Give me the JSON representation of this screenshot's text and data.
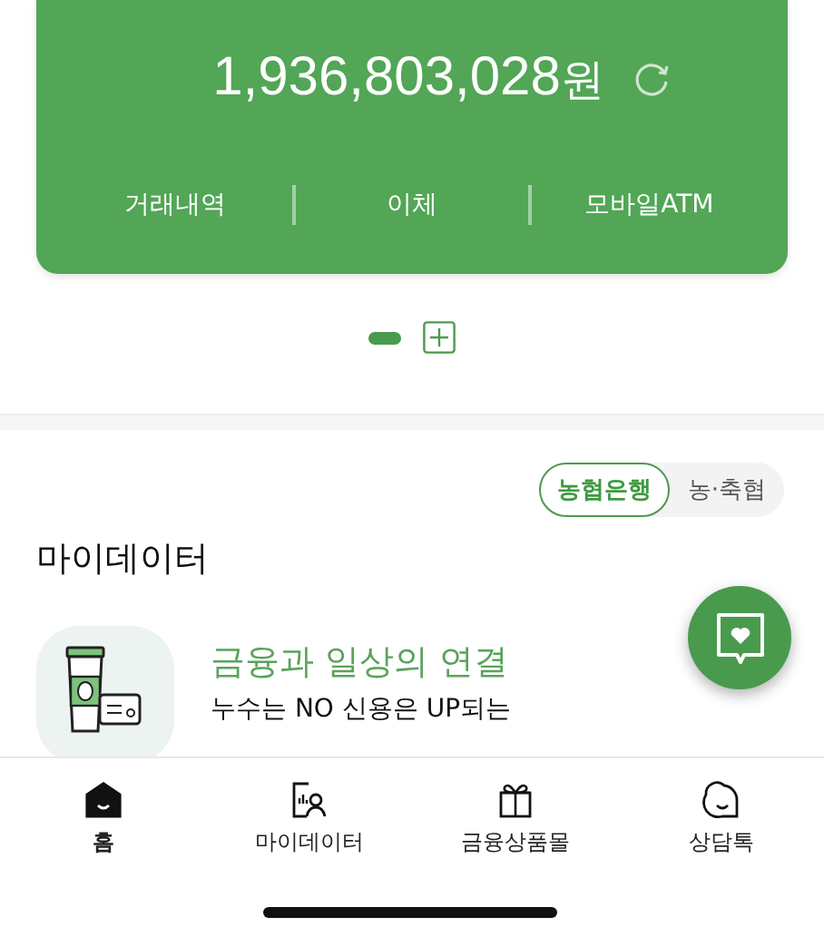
{
  "account_card": {
    "balance": "1,936,803,028",
    "currency": "원",
    "actions": [
      {
        "label": "거래내역"
      },
      {
        "label": "이체"
      },
      {
        "label": "모바일ATM"
      }
    ]
  },
  "pager": {
    "pages": [
      {
        "selected": true
      }
    ]
  },
  "bank_toggle": [
    {
      "label": "농협은행",
      "selected": true
    },
    {
      "label": "농·축협",
      "selected": false
    }
  ],
  "mydata": {
    "title": "마이데이터",
    "promo_title": "금융과 일상의 연결",
    "promo_text": "누수는 NO 신용은 UP되는"
  },
  "tab_bar": [
    {
      "label": "홈",
      "kind": "home",
      "selected": true
    },
    {
      "label": "마이데이터",
      "kind": "mydata",
      "selected": false
    },
    {
      "label": "금융상품몰",
      "kind": "shop",
      "selected": false
    },
    {
      "label": "상담톡",
      "kind": "chat",
      "selected": false
    }
  ]
}
